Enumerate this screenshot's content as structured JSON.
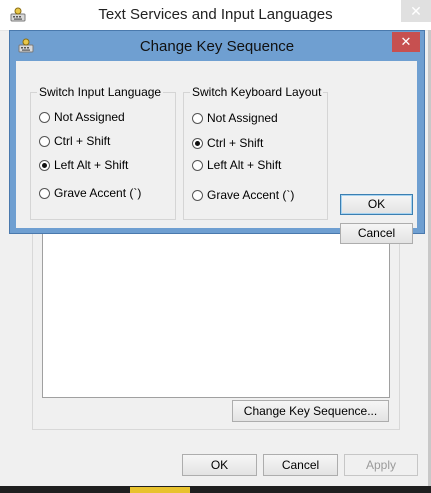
{
  "parent_window": {
    "title": "Text Services and Input Languages",
    "close_glyph": "✕",
    "change_key_sequence_label": "Change Key Sequence...",
    "ok_label": "OK",
    "cancel_label": "Cancel",
    "apply_label": "Apply"
  },
  "dialog": {
    "title": "Change Key Sequence",
    "close_glyph": "✕",
    "switch_input_language": {
      "title": "Switch Input Language",
      "options": [
        "Not Assigned",
        "Ctrl + Shift",
        "Left Alt + Shift",
        "Grave Accent (`)"
      ],
      "selected_index": 2
    },
    "switch_keyboard_layout": {
      "title": "Switch Keyboard Layout",
      "options": [
        "Not Assigned",
        "Ctrl + Shift",
        "Left Alt + Shift",
        "Grave Accent (`)"
      ],
      "selected_index": 1
    },
    "ok_label": "OK",
    "cancel_label": "Cancel"
  },
  "colors": {
    "dialog_frame": "#6f9fd1",
    "close_button": "#c75050"
  }
}
